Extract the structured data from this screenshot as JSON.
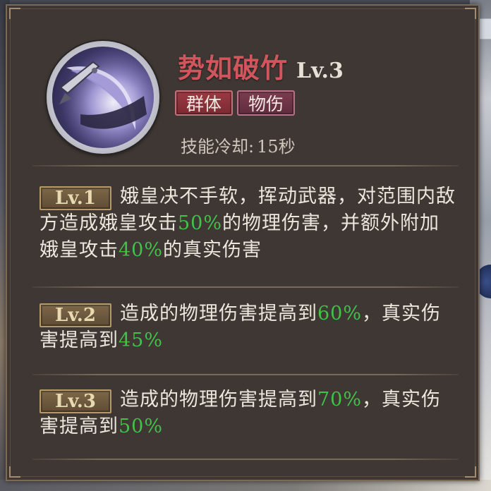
{
  "skill": {
    "name": "势如破竹",
    "level": "Lv.3",
    "icon": "crescent-blade-icon",
    "tags": [
      "群体",
      "物伤"
    ],
    "cooldown_label": "技能冷却:",
    "cooldown_value": "15秒"
  },
  "levels": [
    {
      "badge": "Lv.1",
      "parts": [
        "娥皇决不手软，挥动武器，对范围内敌方造成娥皇攻击",
        "50%",
        "的物理伤害，并额外附加娥皇攻击",
        "40%",
        "的真实伤害"
      ]
    },
    {
      "badge": "Lv.2",
      "parts": [
        "造成的物理伤害提高到",
        "60%",
        "，真实伤害提高到",
        "45%"
      ]
    },
    {
      "badge": "Lv.3",
      "parts": [
        "造成的物理伤害提高到",
        "70%",
        "，真实伤害提高到",
        "50%"
      ]
    }
  ],
  "colors": {
    "skill_name": "#d1555c",
    "highlight": "#43c04a",
    "panel": "#3e3734"
  }
}
